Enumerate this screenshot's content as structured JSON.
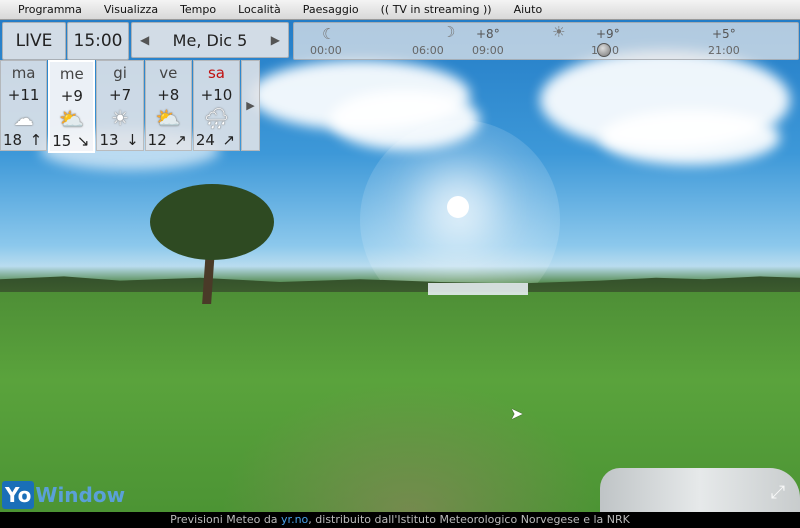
{
  "menu": [
    "Programma",
    "Visualizza",
    "Tempo",
    "Località",
    "Paesaggio",
    "(( TV in streaming ))",
    "Aiuto"
  ],
  "controls": {
    "live": "LIVE",
    "time": "15:00",
    "date": "Me, Dic 5",
    "prev_arrow": "◀",
    "next_arrow": "▶"
  },
  "timeline": {
    "hours": [
      "00:00",
      "06:00",
      "09:00",
      "21:00"
    ],
    "hidden_hour_partial": "1",
    "hidden_hour_tail": "0",
    "temps": [
      "+8°",
      "+9°",
      "+5°"
    ]
  },
  "forecast": [
    {
      "day": "ma",
      "temp": "+11",
      "icon": "cloud-icon",
      "glyph": "☁",
      "wind": "18",
      "dir": "↑",
      "red": false
    },
    {
      "day": "me",
      "temp": "+9",
      "icon": "partly-sunny-icon",
      "glyph": "⛅",
      "wind": "15",
      "dir": "↘",
      "red": false
    },
    {
      "day": "gi",
      "temp": "+7",
      "icon": "sun-icon",
      "glyph": "☀",
      "wind": "13",
      "dir": "↓",
      "red": false
    },
    {
      "day": "ve",
      "temp": "+8",
      "icon": "partly-sunny-icon",
      "glyph": "⛅",
      "wind": "12",
      "dir": "↗",
      "red": false
    },
    {
      "day": "sa",
      "temp": "+10",
      "icon": "rain-icon",
      "glyph": "🌧",
      "wind": "24",
      "dir": "↗",
      "red": true
    }
  ],
  "forecast_more": "▶",
  "logo": {
    "yo": "Yo",
    "window": "Window"
  },
  "footer": {
    "prefix": "Previsioni Meteo da ",
    "link": "yr.no",
    "suffix": ", distribuito dall'Istituto Meteorologico Norvegese e la NRK"
  }
}
